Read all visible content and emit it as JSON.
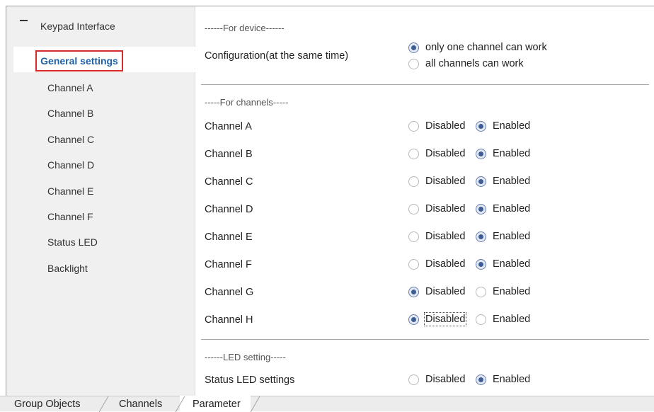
{
  "sidebar": {
    "root_label": "Keypad Interface",
    "selected_item": "General settings",
    "items": [
      "Channel A",
      "Channel B",
      "Channel C",
      "Channel D",
      "Channel E",
      "Channel F",
      "Status LED",
      "Backlight"
    ]
  },
  "main": {
    "device_section": "------For device------",
    "configuration": {
      "label": "Configuration(at the same time)",
      "options": [
        "only one channel can work",
        "all channels can work"
      ],
      "selected": 0
    },
    "channels_section": "-----For channels-----",
    "option_labels": {
      "disabled": "Disabled",
      "enabled": "Enabled"
    },
    "channels": [
      {
        "label": "Channel A",
        "value": "Enabled"
      },
      {
        "label": "Channel B",
        "value": "Enabled"
      },
      {
        "label": "Channel C",
        "value": "Enabled"
      },
      {
        "label": "Channel D",
        "value": "Enabled"
      },
      {
        "label": "Channel E",
        "value": "Enabled"
      },
      {
        "label": "Channel F",
        "value": "Enabled"
      },
      {
        "label": "Channel G",
        "value": "Disabled"
      },
      {
        "label": "Channel H",
        "value": "Disabled"
      }
    ],
    "led_section": "------LED setting-----",
    "status_led": {
      "label": "Status LED settings",
      "value": "Enabled"
    }
  },
  "tabs": [
    "Group Objects",
    "Channels",
    "Parameter"
  ],
  "active_tab": "Parameter",
  "colors": {
    "highlight_border": "#d62b2b",
    "selected_text": "#1f5fa5",
    "radio_selected": "#3f5c95"
  }
}
